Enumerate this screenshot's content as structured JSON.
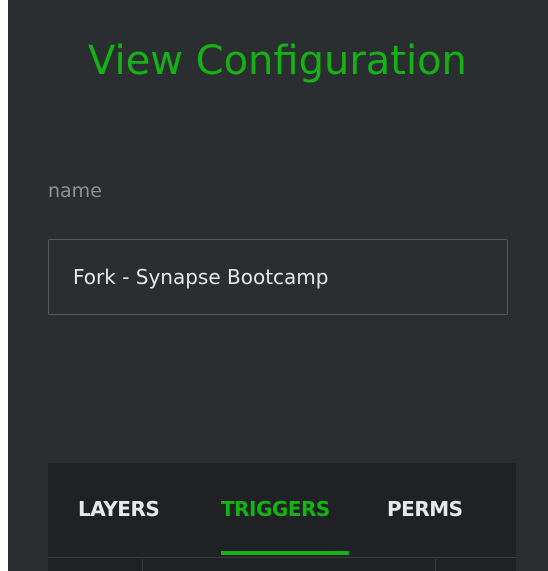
{
  "header": {
    "title": "View Configuration"
  },
  "form": {
    "name_label": "name",
    "name_value": "Fork - Synapse Bootcamp"
  },
  "tabs": [
    {
      "label": "LAYERS",
      "active": false
    },
    {
      "label": "TRIGGERS",
      "active": true
    },
    {
      "label": "PERMS",
      "active": false
    }
  ],
  "colors": {
    "accent": "#15b215",
    "panel_background": "#2b2e31",
    "tabs_background": "#1f2124",
    "label_text": "#8e9196",
    "input_text": "#e6e7e8"
  }
}
